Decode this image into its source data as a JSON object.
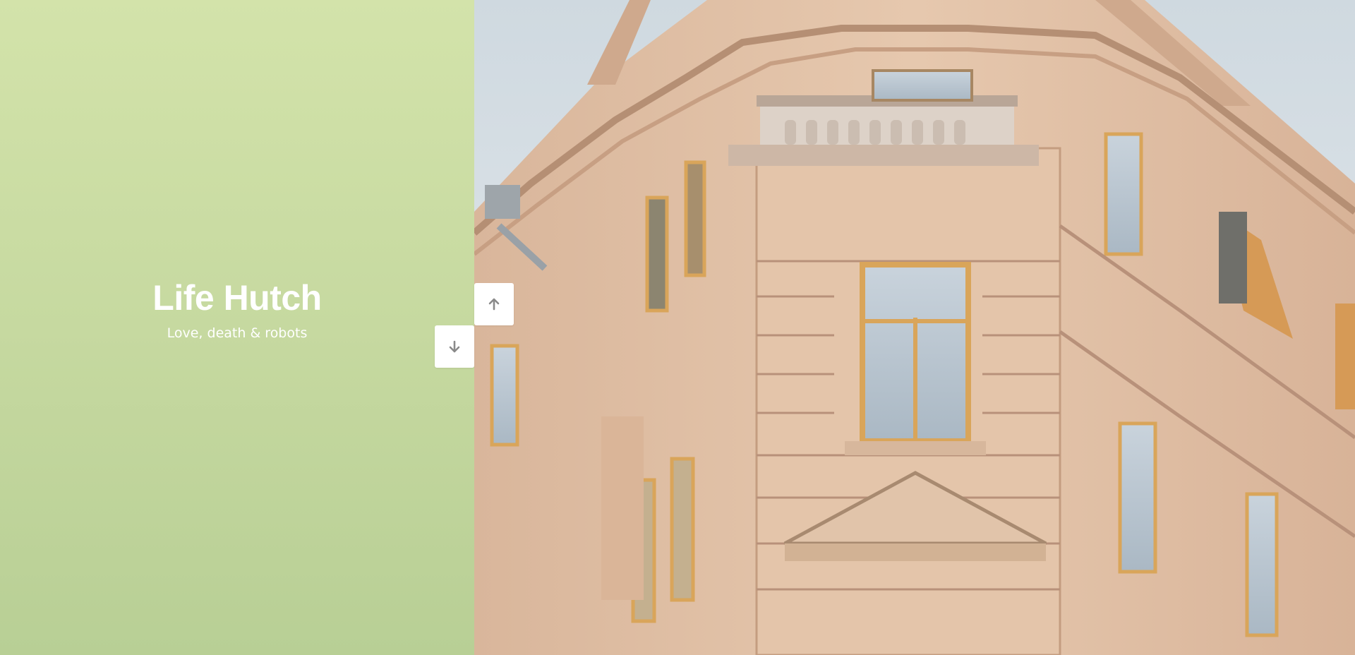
{
  "site": {
    "title": "Life Hutch",
    "tagline": "Love, death & robots"
  },
  "navigation": {
    "up_icon": "arrow-up-icon",
    "down_icon": "arrow-down-icon"
  },
  "colors": {
    "panel_top": "#d3e3aa",
    "panel_bottom": "#b8cf95",
    "button_bg": "#ffffff",
    "arrow_color": "#8a8a8a",
    "facade": "#e2c2a8",
    "window_frame": "#d9a55a"
  }
}
